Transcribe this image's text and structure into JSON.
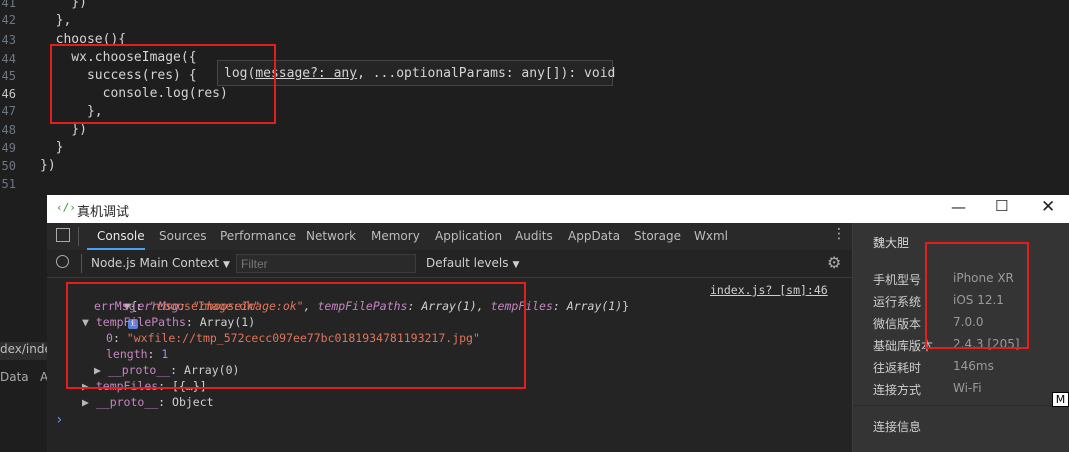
{
  "editor": {
    "line_numbers": [
      "41",
      "42",
      "43",
      "44",
      "45",
      "46",
      "47",
      "48",
      "49",
      "50",
      "51"
    ],
    "lines": [
      "    })",
      "  },",
      "  choose(){",
      "    wx.chooseImage({",
      "      success(res) {",
      "        console.log(res)",
      "      },",
      "    })",
      "  }",
      "})",
      ""
    ],
    "hint_prefix": "log(",
    "hint_param": "message?: any",
    "hint_suffix": ", ...optionalParams: any[]): void"
  },
  "leftstrip": {
    "path_text": "dex/index",
    "tab_text": "Data",
    "tab_text2": "A"
  },
  "devtools": {
    "title": "真机调试",
    "tabs": [
      "Console",
      "Sources",
      "Performance",
      "Network",
      "Memory",
      "Application",
      "Audits",
      "AppData",
      "Storage",
      "Wxml"
    ],
    "context": "Node.js Main Context",
    "filter_placeholder": "Filter",
    "levels": "Default levels",
    "console": {
      "summary_open": "{",
      "summary_key1": "errMsg",
      "summary_val1": "\"chooseImage:ok\"",
      "summary_key2": "tempFilePaths",
      "summary_val2": "Array(1)",
      "summary_key3": "tempFiles",
      "summary_val3": "Array(1)",
      "summary_close": "}",
      "source_link": "index.js? [sm]:46",
      "errMsg_key": "errMsg",
      "errMsg_val": "\"chooseImage:ok\"",
      "paths_key": "tempFilePaths",
      "paths_val": "Array(1)",
      "path0_key": "0",
      "path0_val": "\"wxfile://tmp_572cecc097ee77bc0181934781193217.jpg\"",
      "length_key": "length",
      "length_val": "1",
      "proto1_key": "__proto__",
      "proto1_val": "Array(0)",
      "files_key": "tempFiles",
      "files_val": "[{…}]",
      "proto2_key": "__proto__",
      "proto2_val": "Object",
      "prompt": "›"
    }
  },
  "device": {
    "name": "魏大胆",
    "rows": [
      {
        "label": "手机型号",
        "value": "iPhone XR"
      },
      {
        "label": "运行系统",
        "value": "iOS 12.1"
      },
      {
        "label": "微信版本",
        "value": "7.0.0"
      },
      {
        "label": "基础库版本",
        "value": "2.4.3 [205]"
      },
      {
        "label": "往返耗时",
        "value": "146ms"
      },
      {
        "label": "连接方式",
        "value": "Wi-Fi"
      }
    ],
    "conn_info": "连接信息",
    "badge": "M"
  },
  "colors": {
    "highlight": "#e02020",
    "accent": "#4d9ef7"
  }
}
